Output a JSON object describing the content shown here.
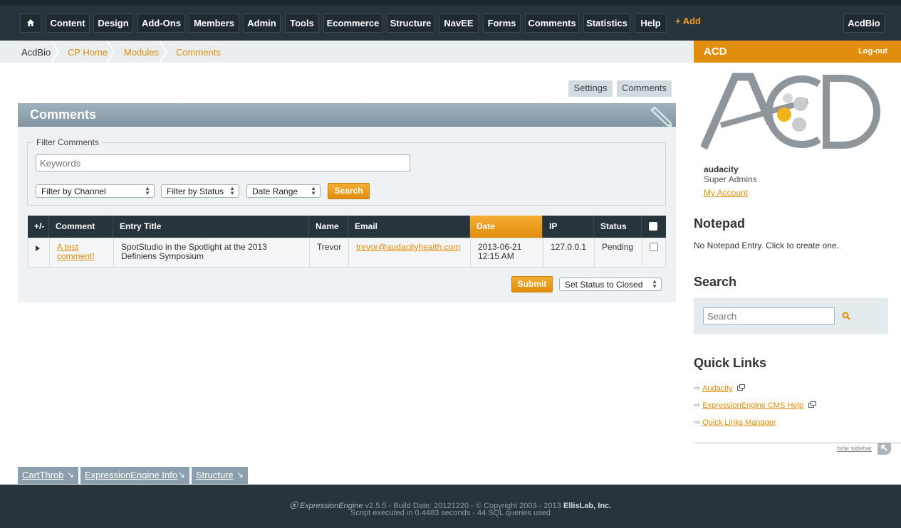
{
  "nav": {
    "home_label": "⌂",
    "items": [
      "Content",
      "Design",
      "Add-Ons",
      "Members",
      "Admin",
      "Tools",
      "Ecommerce",
      "Structure",
      "NavEE",
      "Forms",
      "Comments",
      "Statistics",
      "Help"
    ],
    "add_label": "+ Add",
    "site_button": "AcdBio"
  },
  "breadcrumb": [
    "AcdBio",
    "CP Home",
    "Modules",
    "Comments"
  ],
  "sidebar_header": {
    "site": "ACD",
    "logout": "Log-out"
  },
  "actions": {
    "settings": "Settings",
    "comments": "Comments"
  },
  "panel": {
    "title": "Comments",
    "filter_legend": "Filter Comments",
    "keywords_placeholder": "Keywords",
    "filters": [
      "Filter by Channel",
      "Filter by Status",
      "Date Range"
    ],
    "search_button": "Search"
  },
  "table": {
    "headers": [
      "+/-",
      "Comment",
      "Entry Title",
      "Name",
      "Email",
      "Date",
      "IP",
      "Status"
    ],
    "active_header": "Date",
    "rows": [
      {
        "comment": "A test comment!",
        "entry_title": "SpotStudio in the Spotlight at the 2013 Definiens Symposium",
        "name": "Trevor",
        "email": "trevor@audacityhealth.com",
        "date": "2013-06-21",
        "time": "12:15 AM",
        "ip": "127.0.0.1",
        "status": "Pending"
      }
    ],
    "submit": "Submit",
    "status_action": "Set Status to Closed"
  },
  "user": {
    "name": "audacity",
    "group": "Super Admins",
    "account_link": "My Account"
  },
  "notepad": {
    "title": "Notepad",
    "text": "No Notepad Entry. Click to create one."
  },
  "search": {
    "title": "Search",
    "placeholder": "Search"
  },
  "quick_links": {
    "title": "Quick Links",
    "items": [
      "Audacity",
      "ExpressionEngine CMS Help",
      "Quick Links Manager"
    ]
  },
  "hide_sidebar": "hide sidebar",
  "bottom_tabs": [
    "CartThrob",
    "ExpressionEngine Info",
    "Structure"
  ],
  "footer": {
    "brand": "ExpressionEngine",
    "line1": "v2.5.5 - Build Date: 20121220 - © Copyright 2003 - 2013",
    "company": "EllisLab, Inc.",
    "line2": "Script executed in 0.4483 seconds - 44 SQL queries used"
  },
  "colors": {
    "accent": "#e08e0b",
    "nav_bg": "#27343c",
    "panel_bg": "#eef2f4"
  }
}
